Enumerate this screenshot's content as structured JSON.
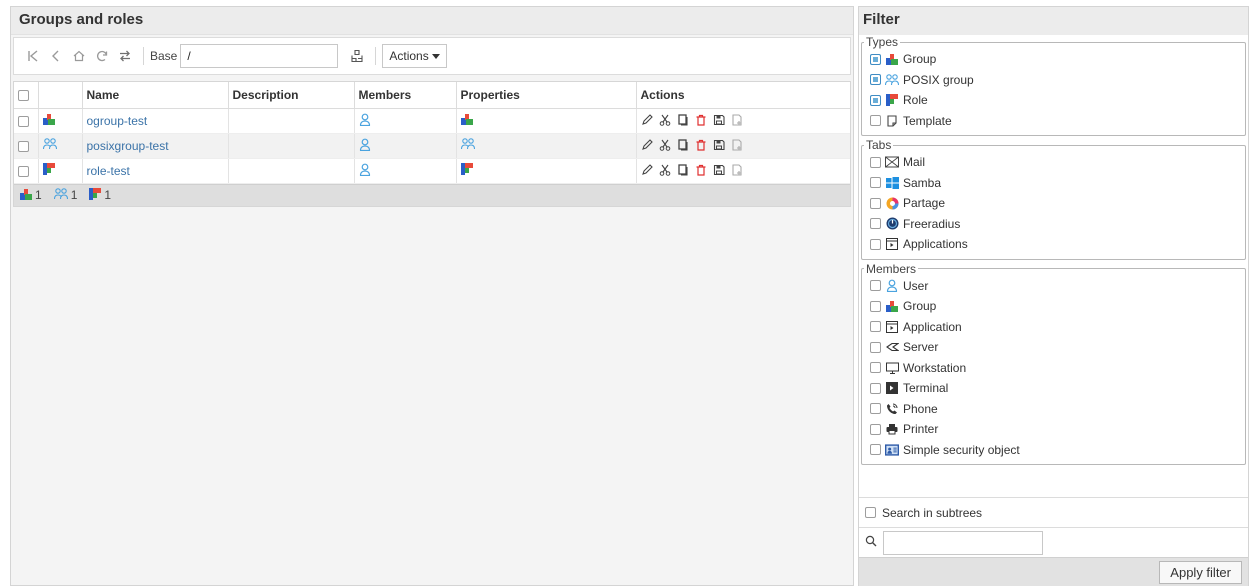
{
  "main": {
    "title": "Groups and roles",
    "toolbar": {
      "base_label": "Base",
      "base_value": "/",
      "actions_label": "Actions"
    },
    "table": {
      "columns": [
        "",
        "",
        "Name",
        "Description",
        "Members",
        "Properties",
        "Actions"
      ],
      "rows": [
        {
          "name": "ogroup-test",
          "description": "",
          "type": "group"
        },
        {
          "name": "posixgroup-test",
          "description": "",
          "type": "posix"
        },
        {
          "name": "role-test",
          "description": "",
          "type": "role"
        }
      ]
    },
    "footer": {
      "group_count": "1",
      "posix_count": "1",
      "role_count": "1"
    }
  },
  "filter": {
    "title": "Filter",
    "types": {
      "legend": "Types",
      "items": [
        {
          "label": "Group",
          "icon": "group-icon",
          "checked": true
        },
        {
          "label": "POSIX group",
          "icon": "posix-group-icon",
          "checked": true
        },
        {
          "label": "Role",
          "icon": "role-icon",
          "checked": true
        },
        {
          "label": "Template",
          "icon": "template-icon",
          "checked": false
        }
      ]
    },
    "tabs": {
      "legend": "Tabs",
      "items": [
        {
          "label": "Mail",
          "icon": "mail-icon",
          "checked": false
        },
        {
          "label": "Samba",
          "icon": "samba-icon",
          "checked": false
        },
        {
          "label": "Partage",
          "icon": "partage-icon",
          "checked": false
        },
        {
          "label": "Freeradius",
          "icon": "freeradius-icon",
          "checked": false
        },
        {
          "label": "Applications",
          "icon": "applications-icon",
          "checked": false
        }
      ]
    },
    "members": {
      "legend": "Members",
      "items": [
        {
          "label": "User",
          "icon": "user-icon",
          "checked": false
        },
        {
          "label": "Group",
          "icon": "group-icon",
          "checked": false
        },
        {
          "label": "Application",
          "icon": "application-icon",
          "checked": false
        },
        {
          "label": "Server",
          "icon": "server-icon",
          "checked": false
        },
        {
          "label": "Workstation",
          "icon": "workstation-icon",
          "checked": false
        },
        {
          "label": "Terminal",
          "icon": "terminal-icon",
          "checked": false
        },
        {
          "label": "Phone",
          "icon": "phone-icon",
          "checked": false
        },
        {
          "label": "Printer",
          "icon": "printer-icon",
          "checked": false
        },
        {
          "label": "Simple security object",
          "icon": "security-object-icon",
          "checked": false
        }
      ]
    },
    "subtree_label": "Search in subtrees",
    "search_value": "",
    "apply_label": "Apply filter"
  },
  "colors": {
    "link": "#3b73a8",
    "checked": "#6aaed8",
    "header_bg": "#ececec"
  }
}
